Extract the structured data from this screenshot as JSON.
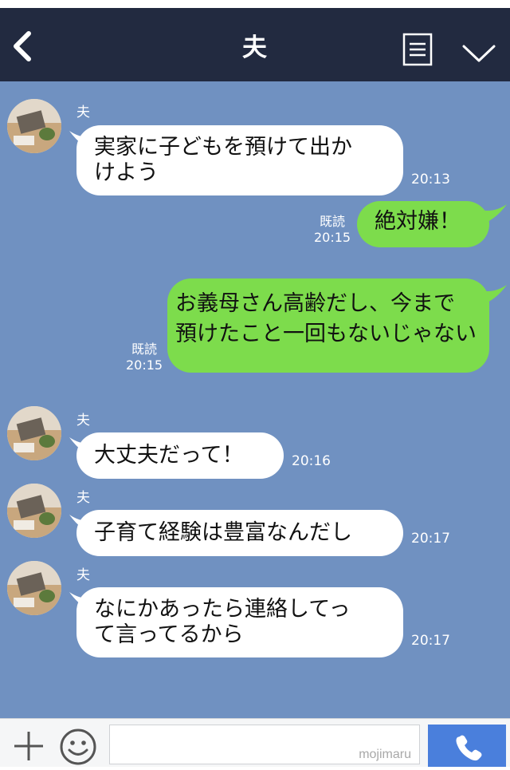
{
  "header": {
    "title": "夫"
  },
  "messages": [
    {
      "type": "in",
      "sender": "夫",
      "lines": [
        "実家に子どもを預けて出か",
        "けよう"
      ],
      "time": "20:13"
    },
    {
      "type": "out",
      "read": "既読",
      "time": "20:15",
      "lines": [
        "絶対嫌！"
      ]
    },
    {
      "type": "out",
      "read": "既読",
      "time": "20:15",
      "lines": [
        "お義母さん高齢だし、今まで",
        "預けたこと一回もないじゃない"
      ]
    },
    {
      "type": "in",
      "sender": "夫",
      "lines": [
        "大丈夫だって！"
      ],
      "time": "20:16"
    },
    {
      "type": "in",
      "sender": "夫",
      "lines": [
        "子育て経験は豊富なんだし"
      ],
      "time": "20:17"
    },
    {
      "type": "in",
      "sender": "夫",
      "lines": [
        "なにかあったら連絡してっ",
        "て言ってるから"
      ],
      "time": "20:17"
    }
  ],
  "input": {
    "watermark": "mojimaru"
  },
  "colors": {
    "header_bg": "#222a40",
    "chat_bg": "#7091c1",
    "incoming_bubble": "#ffffff",
    "outgoing_bubble": "#7ddc4c",
    "call_button": "#4a7fdc"
  },
  "icons": {
    "back": "back-icon",
    "menu": "menu-icon",
    "chevron": "chevron-down-icon",
    "plus": "plus-icon",
    "emoji": "emoji-icon",
    "call": "phone-icon"
  }
}
